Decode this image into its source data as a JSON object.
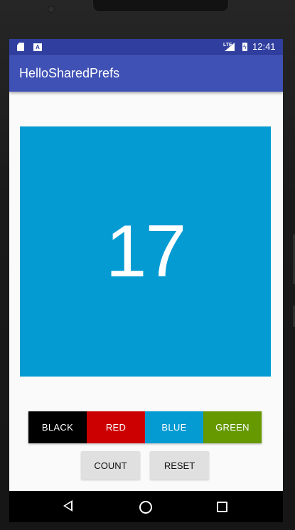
{
  "status_bar": {
    "time": "12:41",
    "sd_icon": "sd-card-icon",
    "notification_icon": "a-notification-icon",
    "signal_label": "LTE",
    "signal_icon": "signal-icon",
    "battery_icon": "battery-charging-icon"
  },
  "app_bar": {
    "title": "HelloSharedPrefs",
    "color": "#3F51B5"
  },
  "count_display": {
    "value": "17",
    "background": "#039BD2"
  },
  "color_buttons": [
    {
      "label": "BLACK",
      "color": "#000000"
    },
    {
      "label": "RED",
      "color": "#CC0000"
    },
    {
      "label": "BLUE",
      "color": "#039BD2"
    },
    {
      "label": "GREEN",
      "color": "#669900"
    }
  ],
  "action_buttons": {
    "count_label": "COUNT",
    "reset_label": "RESET"
  },
  "nav_bar": {
    "back_icon": "back-icon",
    "home_icon": "home-icon",
    "recents_icon": "recents-icon"
  }
}
